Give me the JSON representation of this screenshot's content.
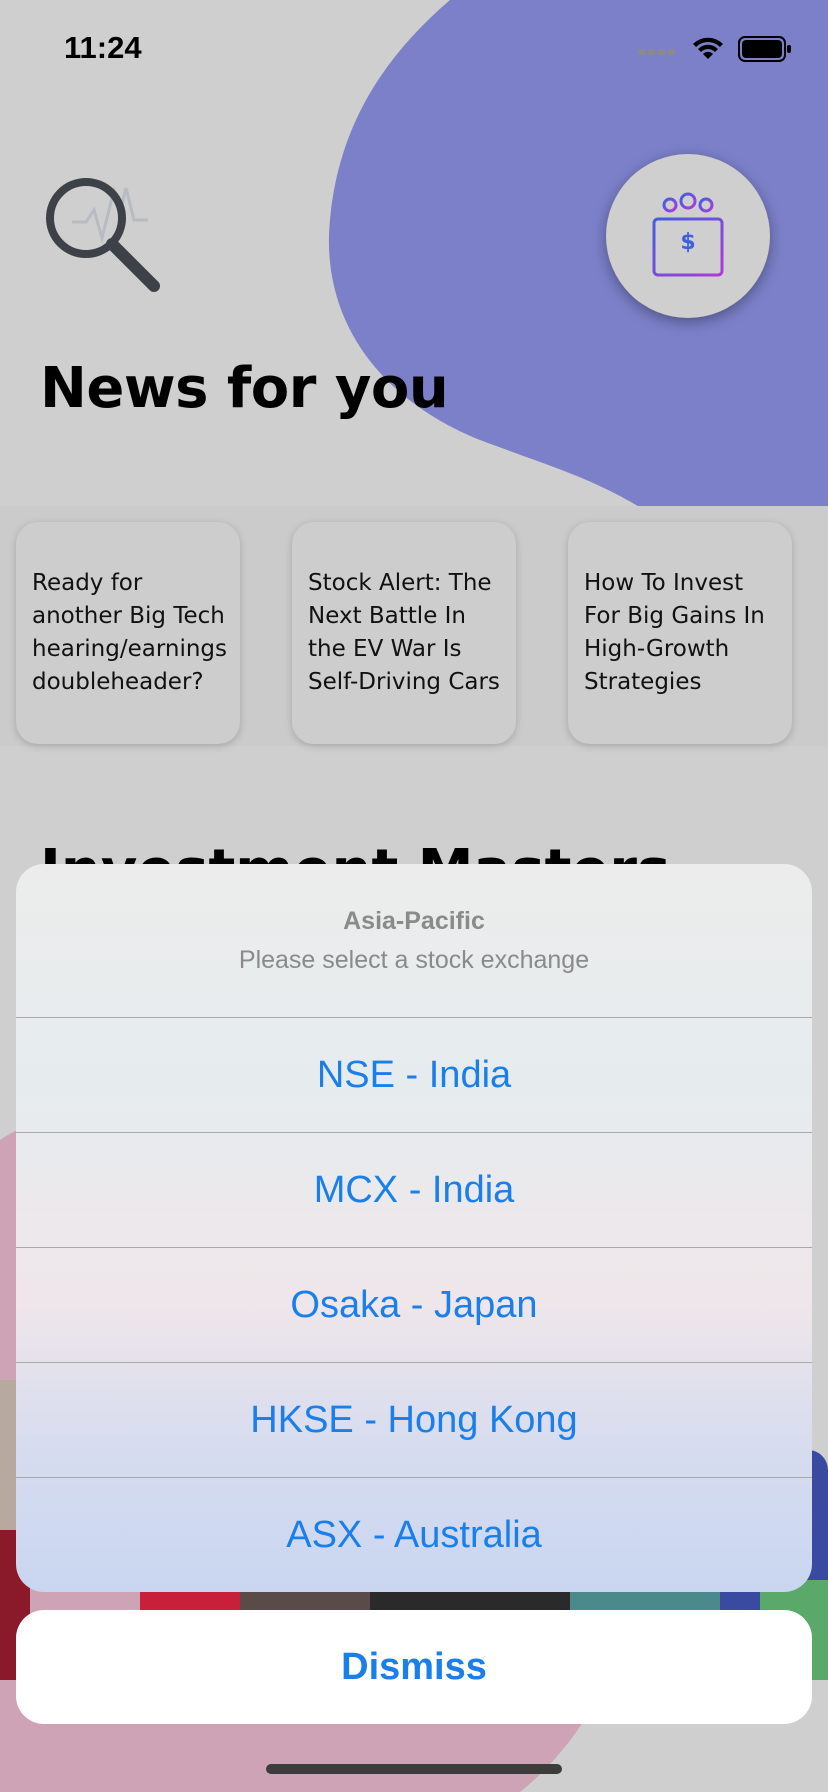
{
  "status_bar": {
    "time": "11:24"
  },
  "home": {
    "news_title": "News for you",
    "news": [
      {
        "title": "Ready for another Big Tech hearing/earnings doubleheader?"
      },
      {
        "title": "Stock Alert: The Next Battle In the EV War Is Self-Driving Cars"
      },
      {
        "title": "How To Invest For Big Gains In High-Growth Strategies"
      }
    ],
    "second_title_partial": "Investment Masters"
  },
  "action_sheet": {
    "title": "Asia-Pacific",
    "subtitle": "Please select a stock exchange",
    "options": [
      {
        "label": "NSE - India"
      },
      {
        "label": "MCX - India"
      },
      {
        "label": "Osaka - Japan"
      },
      {
        "label": "HKSE - Hong Kong"
      },
      {
        "label": "ASX - Australia"
      }
    ],
    "dismiss_label": "Dismiss"
  },
  "colors": {
    "accent": "#1a7fe8",
    "blob_purple": "#7b80c9",
    "blob_pink": "#cfa3b6"
  },
  "icons": [
    "search-chart-logo-icon",
    "investor-money-icon",
    "wifi-icon",
    "battery-icon",
    "signal-icon"
  ]
}
